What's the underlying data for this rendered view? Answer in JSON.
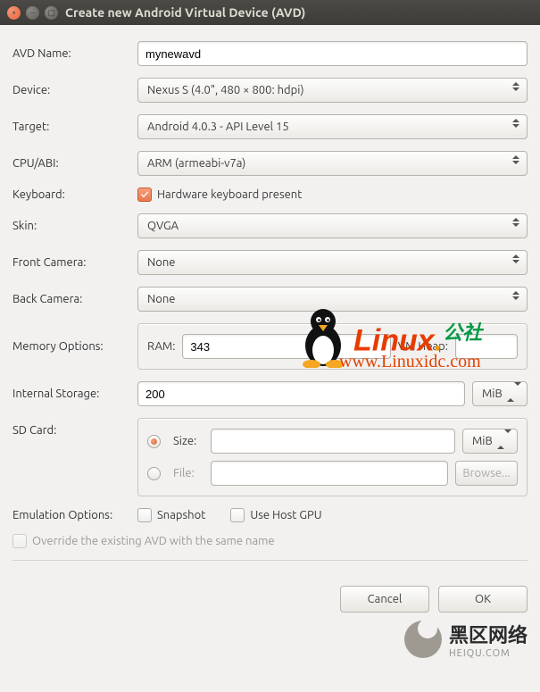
{
  "window": {
    "title": "Create new Android Virtual Device (AVD)"
  },
  "labels": {
    "avd_name": "AVD Name:",
    "device": "Device:",
    "target": "Target:",
    "cpu_abi": "CPU/ABI:",
    "keyboard": "Keyboard:",
    "skin": "Skin:",
    "front_camera": "Front Camera:",
    "back_camera": "Back Camera:",
    "memory_options": "Memory Options:",
    "internal_storage": "Internal Storage:",
    "sd_card": "SD Card:",
    "emulation_options": "Emulation Options:",
    "ram": "RAM:",
    "vm_heap": "VM Heap:",
    "size": "Size:",
    "file": "File:",
    "override": "Override the existing AVD with the same name"
  },
  "values": {
    "avd_name": "mynewavd",
    "device": "Nexus S (4.0\", 480 × 800: hdpi)",
    "target": "Android 4.0.3 - API Level 15",
    "cpu_abi": "ARM (armeabi-v7a)",
    "keyboard_label": "Hardware keyboard present",
    "keyboard_checked": true,
    "skin": "QVGA",
    "front_camera": "None",
    "back_camera": "None",
    "ram": "343",
    "vm_heap": "",
    "internal_storage": "200",
    "internal_storage_unit": "MiB",
    "sd_size": "",
    "sd_size_unit": "MiB",
    "sd_file": "",
    "sd_mode": "size",
    "snapshot_checked": false,
    "use_host_gpu_checked": false,
    "override_checked": false,
    "override_enabled": false
  },
  "options": {
    "snapshot": "Snapshot",
    "use_host_gpu": "Use Host GPU"
  },
  "buttons": {
    "browse": "Browse...",
    "cancel": "Cancel",
    "ok": "OK"
  },
  "watermark": {
    "linux_text_a": "Linux",
    "linux_text_b": "公社",
    "url": "www.Linuxidc.com",
    "heiqu_cn": "黑区网络",
    "heiqu_en": "HEIQU.COM"
  }
}
